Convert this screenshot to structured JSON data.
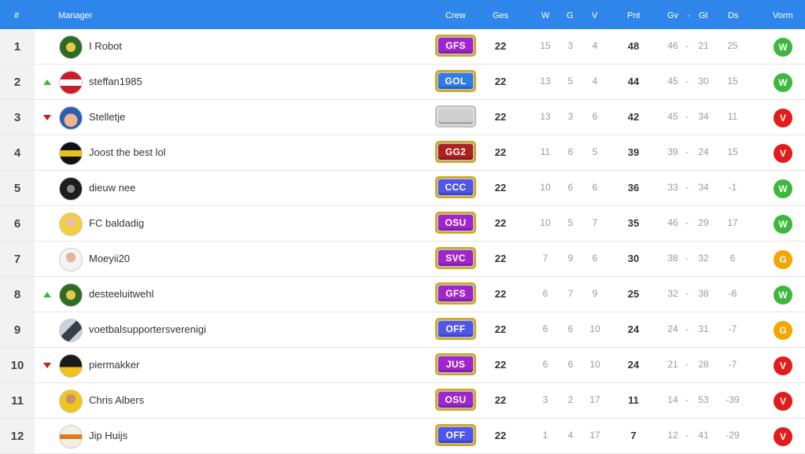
{
  "header": {
    "rank": "#",
    "manager": "Manager",
    "crew": "Crew",
    "played": "Ges",
    "won": "W",
    "drawn": "G",
    "lost": "V",
    "points": "Pnt",
    "goals_for": "Gv",
    "dash": "-",
    "goals_against": "Gt",
    "diff": "Ds",
    "form": "Vorm"
  },
  "colors": {
    "header_bg": "#2f86ea",
    "win": "#3cb83c",
    "loss": "#e21b1b",
    "draw": "#f5a500",
    "trend_up": "#3cb83c",
    "trend_down": "#d0191b"
  },
  "rows": [
    {
      "rank": "1",
      "trend": "none",
      "avatar": "avatar-green-logo",
      "name": "I Robot",
      "crew": "GFS",
      "crew_color": "#a126c9",
      "played": "22",
      "w": "15",
      "g": "3",
      "v": "4",
      "pnt": "48",
      "gv": "46",
      "dash": "-",
      "gt": "21",
      "ds": "25",
      "form": "W",
      "form_color": "#3cb83c"
    },
    {
      "rank": "2",
      "trend": "up",
      "avatar": "avatar-ajax-flag",
      "name": "steffan1985",
      "crew": "GOL",
      "crew_color": "#2f7de0",
      "played": "22",
      "w": "13",
      "g": "5",
      "v": "4",
      "pnt": "44",
      "gv": "45",
      "dash": "-",
      "gt": "30",
      "ds": "15",
      "form": "W",
      "form_color": "#3cb83c"
    },
    {
      "rank": "3",
      "trend": "down",
      "avatar": "avatar-cartoon-face",
      "name": "Stelletje",
      "crew": "",
      "crew_color": "#cfcfcf",
      "played": "22",
      "w": "13",
      "g": "3",
      "v": "6",
      "pnt": "42",
      "gv": "45",
      "dash": "-",
      "gt": "34",
      "ds": "11",
      "form": "V",
      "form_color": "#e21b1b"
    },
    {
      "rank": "4",
      "trend": "none",
      "avatar": "avatar-yellow-stripe",
      "name": "Joost the best lol",
      "crew": "GG2",
      "crew_color": "#b0201f",
      "played": "22",
      "w": "11",
      "g": "6",
      "v": "5",
      "pnt": "39",
      "gv": "39",
      "dash": "-",
      "gt": "24",
      "ds": "15",
      "form": "V",
      "form_color": "#e21b1b"
    },
    {
      "rank": "5",
      "trend": "none",
      "avatar": "avatar-dark-emblem",
      "name": "dieuw nee",
      "crew": "CCC",
      "crew_color": "#4f56e8",
      "played": "22",
      "w": "10",
      "g": "6",
      "v": "6",
      "pnt": "36",
      "gv": "33",
      "dash": "-",
      "gt": "34",
      "ds": "-1",
      "form": "W",
      "form_color": "#3cb83c"
    },
    {
      "rank": "6",
      "trend": "none",
      "avatar": "avatar-player-photo",
      "name": "FC baldadig",
      "crew": "OSU",
      "crew_color": "#a126c9",
      "played": "22",
      "w": "10",
      "g": "5",
      "v": "7",
      "pnt": "35",
      "gv": "46",
      "dash": "-",
      "gt": "29",
      "ds": "17",
      "form": "W",
      "form_color": "#3cb83c"
    },
    {
      "rank": "7",
      "trend": "none",
      "avatar": "avatar-player-white",
      "name": "Moeyii20",
      "crew": "SVC",
      "crew_color": "#a126c9",
      "played": "22",
      "w": "7",
      "g": "9",
      "v": "6",
      "pnt": "30",
      "gv": "38",
      "dash": "-",
      "gt": "32",
      "ds": "6",
      "form": "G",
      "form_color": "#f5a500"
    },
    {
      "rank": "8",
      "trend": "up",
      "avatar": "avatar-green-logo",
      "name": "desteeluitwehl",
      "crew": "GFS",
      "crew_color": "#a126c9",
      "played": "22",
      "w": "6",
      "g": "7",
      "v": "9",
      "pnt": "25",
      "gv": "32",
      "dash": "-",
      "gt": "38",
      "ds": "-6",
      "form": "W",
      "form_color": "#3cb83c"
    },
    {
      "rank": "9",
      "trend": "none",
      "avatar": "avatar-shark-fin",
      "name": "voetbalsupportersverenigi",
      "crew": "OFF",
      "crew_color": "#4f56e8",
      "played": "22",
      "w": "6",
      "g": "6",
      "v": "10",
      "pnt": "24",
      "gv": "24",
      "dash": "-",
      "gt": "31",
      "ds": "-7",
      "form": "G",
      "form_color": "#f5a500"
    },
    {
      "rank": "10",
      "trend": "down",
      "avatar": "avatar-jersey-23",
      "name": "piermakker",
      "crew": "JUS",
      "crew_color": "#a126c9",
      "played": "22",
      "w": "6",
      "g": "6",
      "v": "10",
      "pnt": "24",
      "gv": "21",
      "dash": "-",
      "gt": "28",
      "ds": "-7",
      "form": "V",
      "form_color": "#e21b1b"
    },
    {
      "rank": "11",
      "trend": "none",
      "avatar": "avatar-player-yellow",
      "name": "Chris Albers",
      "crew": "OSU",
      "crew_color": "#a126c9",
      "played": "22",
      "w": "3",
      "g": "2",
      "v": "17",
      "pnt": "11",
      "gv": "14",
      "dash": "-",
      "gt": "53",
      "ds": "-39",
      "form": "V",
      "form_color": "#e21b1b"
    },
    {
      "rank": "12",
      "trend": "none",
      "avatar": "avatar-gsm-badge",
      "name": "Jip Huijs",
      "crew": "OFF",
      "crew_color": "#4f56e8",
      "played": "22",
      "w": "1",
      "g": "4",
      "v": "17",
      "pnt": "7",
      "gv": "12",
      "dash": "-",
      "gt": "41",
      "ds": "-29",
      "form": "V",
      "form_color": "#e21b1b"
    }
  ]
}
